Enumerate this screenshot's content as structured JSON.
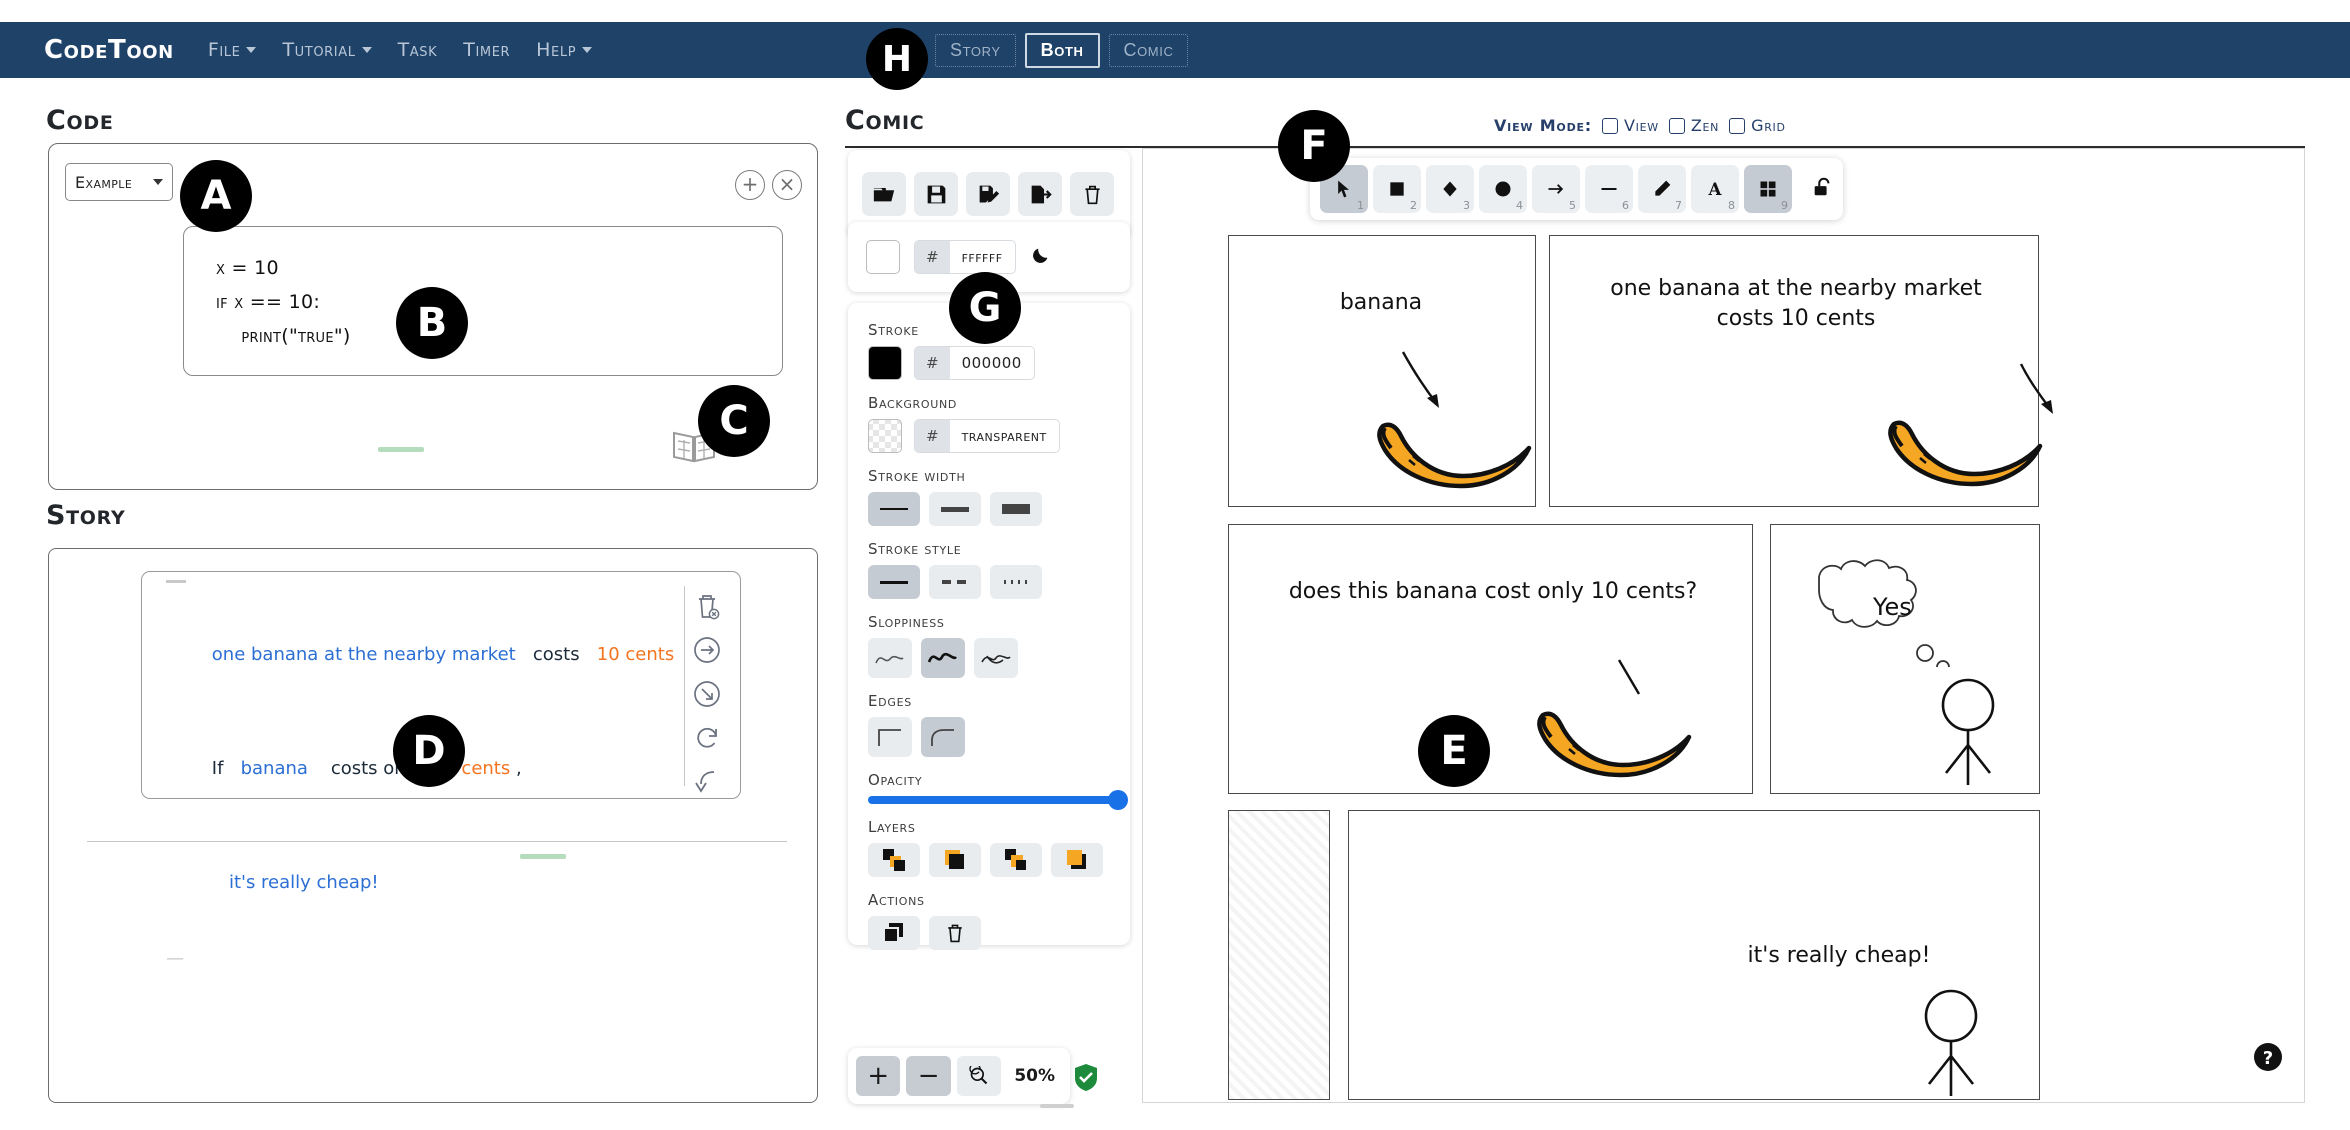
{
  "navbar": {
    "brand": "CodeToon",
    "items": [
      {
        "label": "File",
        "has_caret": true
      },
      {
        "label": "Tutorial",
        "has_caret": true
      },
      {
        "label": "Task",
        "has_caret": false
      },
      {
        "label": "Timer",
        "has_caret": false
      },
      {
        "label": "Help",
        "has_caret": true
      }
    ],
    "mode_buttons": [
      {
        "label": "Story",
        "active": false
      },
      {
        "label": "Both",
        "active": true
      },
      {
        "label": "Comic",
        "active": false
      }
    ],
    "badge_h": "H",
    "bg_color": "#1f4269"
  },
  "code": {
    "title": "Code",
    "example_select": "Example",
    "badge_a": "A",
    "badge_b": "B",
    "badge_c": "C",
    "lines": [
      "x = 10",
      "",
      "if x == 10:",
      "    print(\"true\")"
    ],
    "add_icon": "plus-circle-icon",
    "close_icon": "close-circle-icon",
    "book_icon": "comic-book-icon"
  },
  "story": {
    "title": "Story",
    "badge_d": "D",
    "lines": [
      [
        {
          "text": "one banana at the nearby market",
          "color": "blue"
        },
        {
          "text": "   costs   ",
          "color": "dark"
        },
        {
          "text": "10 cents",
          "color": "orange"
        }
      ],
      [
        {
          "text": "If",
          "color": "dark"
        },
        {
          "text": "   banana   ",
          "color": "blue"
        },
        {
          "text": " costs only  ",
          "color": "dark"
        },
        {
          "text": "10 cents",
          "color": "orange"
        },
        {
          "text": " ,",
          "color": "dark"
        }
      ],
      [
        {
          "text": "   it's really cheap!",
          "color": "blue"
        }
      ]
    ],
    "sidebar_icons": [
      "trash-x-icon",
      "arrow-right-circle-icon",
      "arrow-down-right-circle-icon",
      "refresh-icon",
      "curved-down-arrow-icon"
    ],
    "colors": {
      "blue": "#2b6fd4",
      "orange": "#f4741f",
      "dark": "#1c2b3a"
    }
  },
  "comic": {
    "title": "Comic",
    "badge_e": "E",
    "badge_f": "F",
    "badge_g": "G",
    "file_tools": [
      {
        "name": "open-folder-icon",
        "label": "Open"
      },
      {
        "name": "save-icon",
        "label": "Save"
      },
      {
        "name": "save-as-icon",
        "label": "Save As"
      },
      {
        "name": "export-icon",
        "label": "Export"
      },
      {
        "name": "delete-icon",
        "label": "Delete"
      }
    ],
    "canvas_background": {
      "hash": "#",
      "value": "ffffff",
      "theme_icon": "moon-icon"
    },
    "properties": {
      "stroke": {
        "label": "Stroke",
        "hash": "#",
        "value": "000000",
        "color": "#000000"
      },
      "background": {
        "label": "Background",
        "hash": "#",
        "value": "transparent"
      },
      "stroke_width": {
        "label": "Stroke width",
        "options": [
          "thin",
          "bold",
          "extra-bold"
        ],
        "selected": 0
      },
      "stroke_style": {
        "label": "Stroke style",
        "options": [
          "solid",
          "dashed",
          "dotted"
        ],
        "selected": 0
      },
      "sloppiness": {
        "label": "Sloppiness",
        "options": [
          "architect",
          "artist",
          "cartoonist"
        ],
        "selected": 1
      },
      "edges": {
        "label": "Edges",
        "options": [
          "sharp",
          "round"
        ],
        "selected": 1
      },
      "opacity": {
        "label": "Opacity",
        "value": 100
      },
      "layers": {
        "label": "Layers",
        "options": [
          "send-to-back",
          "send-backward",
          "bring-forward",
          "bring-to-front"
        ]
      },
      "actions": {
        "label": "Actions",
        "options": [
          "duplicate-icon",
          "delete-icon"
        ]
      }
    },
    "shape_tools": [
      {
        "name": "selection-tool",
        "num": "1",
        "selected": true
      },
      {
        "name": "rectangle-tool",
        "num": "2",
        "selected": false
      },
      {
        "name": "diamond-tool",
        "num": "3",
        "selected": false
      },
      {
        "name": "ellipse-tool",
        "num": "4",
        "selected": false
      },
      {
        "name": "arrow-tool",
        "num": "5",
        "selected": false
      },
      {
        "name": "line-tool",
        "num": "6",
        "selected": false
      },
      {
        "name": "draw-tool",
        "num": "7",
        "selected": false
      },
      {
        "name": "text-tool",
        "num": "8",
        "selected": false
      },
      {
        "name": "frame-tool",
        "num": "9",
        "selected": true
      }
    ],
    "lock_icon": "unlock-icon",
    "view_mode": {
      "label": "View Mode:",
      "options": [
        {
          "label": "View",
          "checked": false
        },
        {
          "label": "Zen",
          "checked": false
        },
        {
          "label": "Grid",
          "checked": false
        }
      ]
    },
    "zoom": {
      "zoom_in": "+",
      "zoom_out": "−",
      "reset": "reset-zoom-icon",
      "percent": "50%",
      "status_icon": "shield-check-icon"
    },
    "help_icon": "help-circle-icon",
    "panels": [
      {
        "id": "panel-1",
        "text": "banana",
        "has_banana": true,
        "has_arrow": true,
        "has_figure": false
      },
      {
        "id": "panel-2",
        "text": "one banana at the nearby market\ncosts 10 cents",
        "has_banana": true,
        "has_arrow": true,
        "has_figure": false
      },
      {
        "id": "panel-3",
        "text": "does this banana cost only 10 cents?",
        "has_banana": true,
        "has_arrow": true,
        "has_figure": false
      },
      {
        "id": "panel-4",
        "text": "Yes",
        "has_banana": false,
        "has_arrow": false,
        "has_figure": true,
        "has_thought_bubble": true
      },
      {
        "id": "panel-5",
        "text": "it's really cheap!",
        "has_banana": false,
        "has_arrow": true,
        "has_figure": true
      }
    ],
    "banana_color": "#f5a623"
  }
}
